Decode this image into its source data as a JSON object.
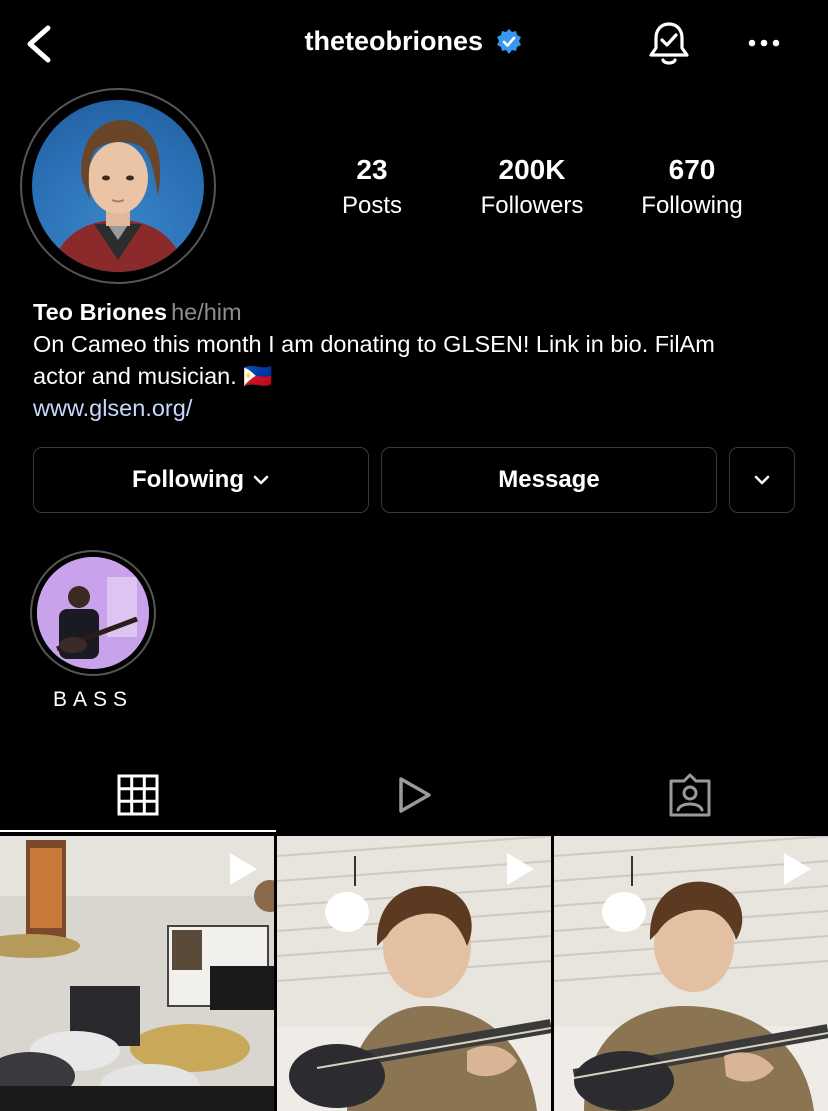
{
  "header": {
    "username": "theteobriones",
    "verified": true,
    "icons": [
      "back-icon",
      "verified-badge-icon",
      "notification-bell-icon",
      "more-options-icon"
    ]
  },
  "profile": {
    "stats": [
      {
        "value": "23",
        "label": "Posts"
      },
      {
        "value": "200K",
        "label": "Followers"
      },
      {
        "value": "670",
        "label": "Following"
      }
    ],
    "name": "Teo Briones",
    "pronouns": "he/him",
    "bio_line1": "On Cameo this month I am donating to GLSEN! Link in bio. FilAm",
    "bio_line2": "actor and musician. 🇵🇭",
    "website": "www.glsen.org/"
  },
  "actions": {
    "following_label": "Following",
    "message_label": "Message"
  },
  "highlights": [
    {
      "label": "BASS"
    }
  ],
  "tabs": [
    {
      "name": "posts-grid",
      "icon": "grid-icon",
      "active": true
    },
    {
      "name": "reels",
      "icon": "reels-play-icon",
      "active": false
    },
    {
      "name": "tagged",
      "icon": "tagged-person-icon",
      "active": false
    }
  ],
  "posts": [
    {
      "type": "video",
      "scene": "drum kit in room"
    },
    {
      "type": "video",
      "scene": "playing bass guitar"
    },
    {
      "type": "video",
      "scene": "playing bass guitar"
    }
  ],
  "colors": {
    "background": "#000000",
    "verified": "#3897f0",
    "link": "#c7d8ff",
    "secondary_text": "#8e8e8e",
    "border": "#3a3a3a"
  }
}
